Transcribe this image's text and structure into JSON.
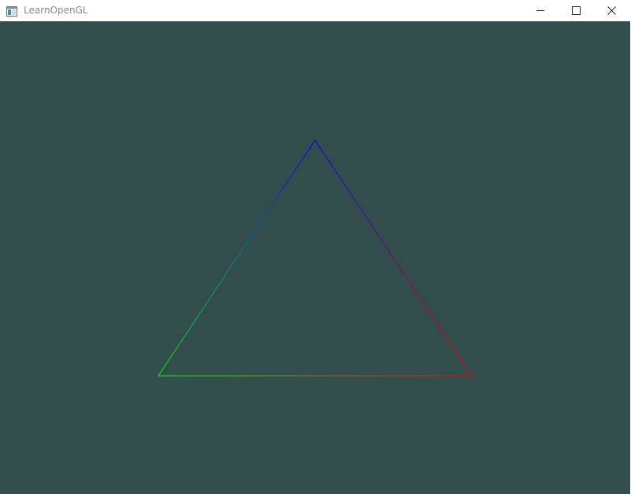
{
  "window": {
    "title": "LearnOpenGL",
    "controls": [
      "minimize",
      "maximize",
      "close"
    ]
  },
  "colors": {
    "clear": "#334d4d",
    "vertex_top": "#0000ff",
    "vertex_bottom_left": "#00ff00",
    "vertex_bottom_right": "#ff0000"
  },
  "icons": {
    "app": "app-window-icon",
    "minimize": "minimize-icon",
    "maximize": "maximize-icon",
    "close": "close-icon"
  }
}
